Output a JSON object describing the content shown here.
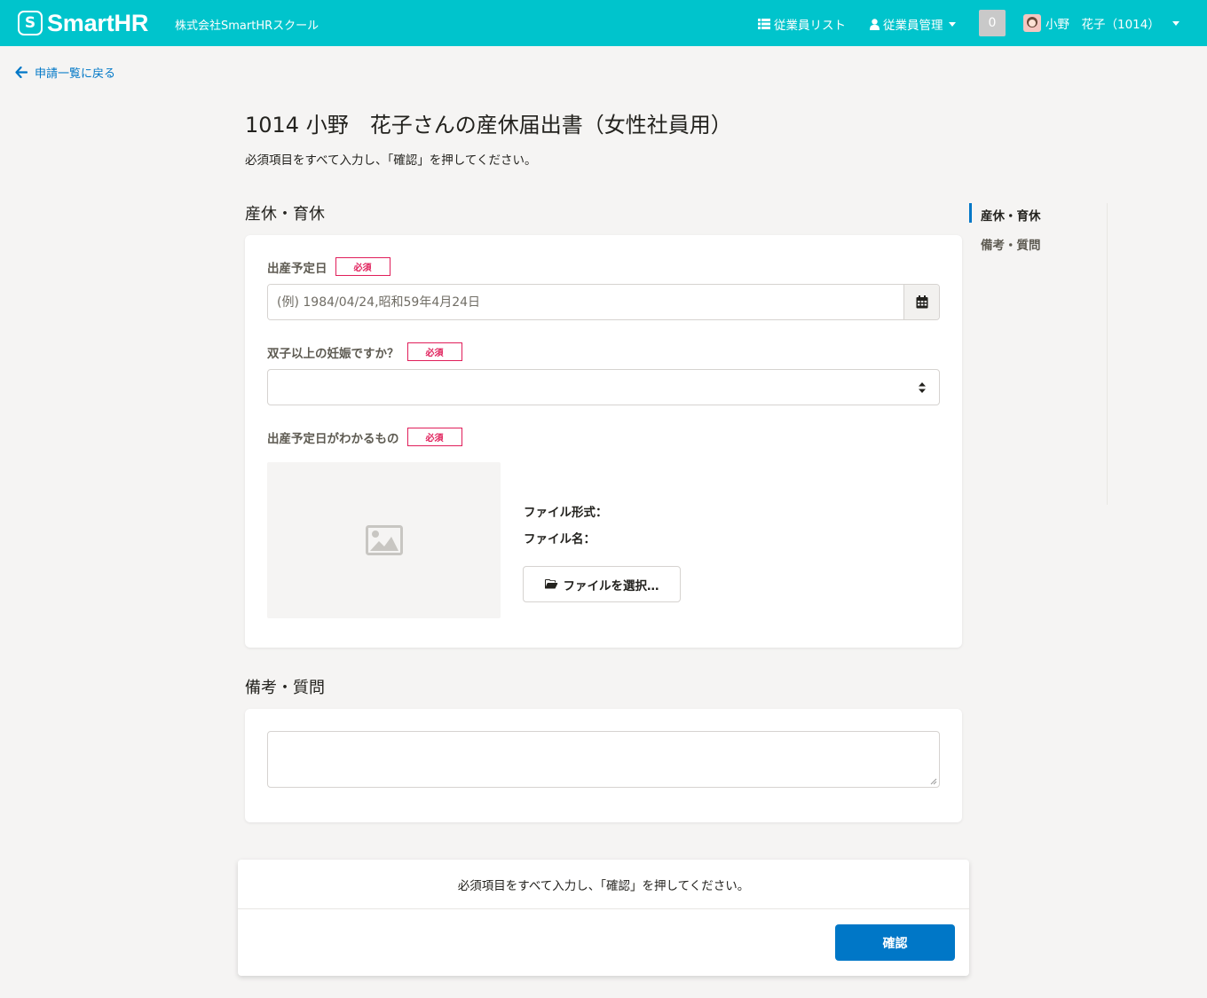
{
  "header": {
    "logo_mark": "S",
    "logo_text": "SmartHR",
    "company": "株式会社SmartHRスクール",
    "nav_employee_list": "従業員リスト",
    "nav_employee_manage": "従業員管理",
    "notification_count": "0",
    "user_name": "小野　花子（1014）"
  },
  "back_link": "申請一覧に戻る",
  "page": {
    "title": "1014 小野　花子さんの産休届出書（女性社員用）",
    "description": "必須項目をすべて入力し、「確認」を押してください。"
  },
  "section1": {
    "title": "産休・育休",
    "due_date_label": "出産予定日",
    "due_date_placeholder": "(例) 1984/04/24,昭和59年4月24日",
    "twins_label": "双子以上の妊娠ですか？",
    "proof_label": "出産予定日がわかるもの",
    "file_format_label": "ファイル形式：",
    "file_name_label": "ファイル名：",
    "file_button": "ファイルを選択…",
    "required": "必須"
  },
  "section2": {
    "title": "備考・質問"
  },
  "side_nav": {
    "items": [
      "産休・育休",
      "備考・質問"
    ]
  },
  "footer": {
    "message": "必須項目をすべて入力し、「確認」を押してください。",
    "confirm": "確認"
  },
  "colors": {
    "header": "#00c4cc",
    "accent": "#0077c7",
    "required": "#e01e5a"
  },
  "icons": [
    "logo-icon",
    "list-icon",
    "user-icon",
    "arrow-left-icon",
    "calendar-icon",
    "sort-icon",
    "image-icon",
    "folder-open-icon"
  ]
}
